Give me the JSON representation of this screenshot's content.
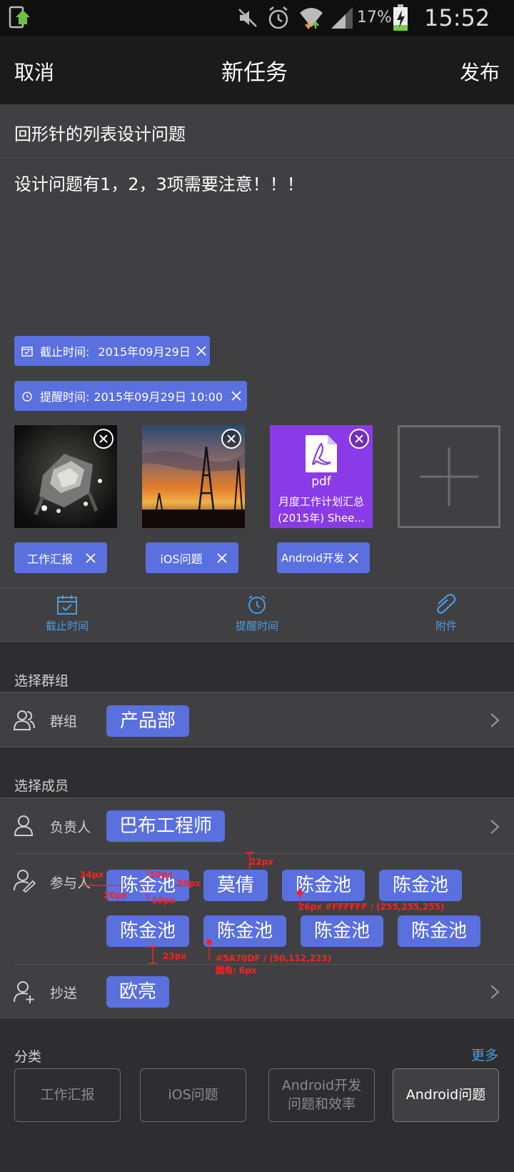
{
  "status_bar": {
    "battery": "17%",
    "time": "15:52"
  },
  "nav": {
    "cancel": "取消",
    "title": "新任务",
    "publish": "发布"
  },
  "task": {
    "title": "回形针的列表设计问题",
    "body": "设计问题有1，2，3项需要注意！！！"
  },
  "deadline_chip": {
    "label": "截止时间:",
    "value": "2015年09月29日"
  },
  "reminder_chip": {
    "label": "提醒时间:",
    "value": "2015年09月29日 10:00"
  },
  "attachments": {
    "pdf_type": "pdf",
    "pdf_name_line1": "月度工作计划汇总",
    "pdf_name_line2": "(2015年) Shee..."
  },
  "tags": [
    "工作汇报",
    "iOS问题",
    "Android开发"
  ],
  "toolbar": {
    "deadline": "截止时间",
    "reminder": "提醒时间",
    "attachment": "附件"
  },
  "group_section": {
    "header": "选择群组",
    "label": "群组",
    "value": "产品部"
  },
  "member_section": {
    "header": "选择成员",
    "owner_label": "负责人",
    "owner": "巴布工程师",
    "participants_label": "参与人",
    "participants": [
      "陈金池",
      "莫倩",
      "陈金池",
      "陈金池",
      "陈金池",
      "陈金池",
      "陈金池",
      "陈金池"
    ],
    "cc_label": "抄送",
    "cc": "欧亮"
  },
  "annotations": {
    "a1": "22px",
    "a2": "34px",
    "a3": "10px",
    "a4": "20px",
    "a5": "20px",
    "a6": "10px",
    "a7": "26px #FFFFFF / (255,255,255)",
    "a8": "23px",
    "a9": "#5A70DF / (90,112,223)",
    "a10": "圆角: 6px"
  },
  "category": {
    "header": "分类",
    "more": "更多",
    "items": [
      "工作汇报",
      "iOS问题",
      "Android开发\n问题和效率",
      "Android问题"
    ]
  },
  "colors": {
    "accent": "#5a70df",
    "link": "#4a9be3",
    "background": "#2e2e30",
    "panel": "#404042"
  }
}
